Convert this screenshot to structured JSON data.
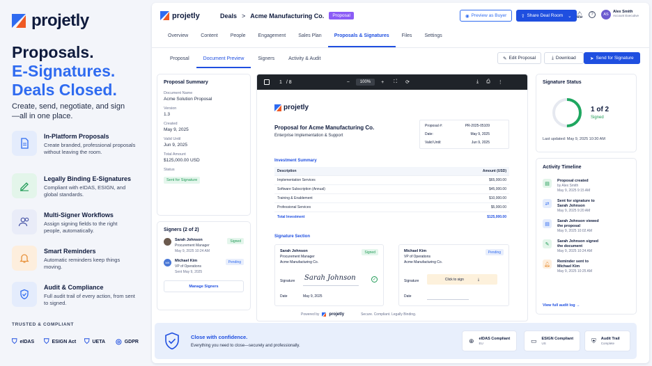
{
  "brand": {
    "name": "projetly"
  },
  "hero": {
    "line1": "Proposals.",
    "line2": "E-Signatures.",
    "line3": "Deals Closed.",
    "sub": "Create, send, negotiate, and sign—all in one place."
  },
  "features": [
    {
      "title": "In-Platform Proposals",
      "desc": "Create branded, professional proposals without leaving the room.",
      "icon": "document-icon"
    },
    {
      "title": "Legally Binding E-Signatures",
      "desc": "Compliant with eIDAS, ESIGN, and global standards.",
      "icon": "pen-signature-icon"
    },
    {
      "title": "Multi-Signer Workflows",
      "desc": "Assign signing fields to the right people, automatically.",
      "icon": "users-icon"
    },
    {
      "title": "Smart Reminders",
      "desc": "Automatic reminders keep things moving.",
      "icon": "bell-icon"
    },
    {
      "title": "Audit & Compliance",
      "desc": "Full audit trail of every action, from sent to signed.",
      "icon": "shield-check-icon"
    }
  ],
  "trusted": {
    "label": "TRUSTED & COMPLIANT",
    "items": [
      "eIDAS",
      "ESIGN Act",
      "UETA",
      "GDPR"
    ]
  },
  "topbar": {
    "crumb_root": "Deals",
    "crumb_sep": ">",
    "crumb_current": "Acme Manufacturing Co.",
    "pill": "Proposal",
    "preview_btn": "Preview as Buyer",
    "share_btn": "Share Deal Room",
    "user_initials": "AS",
    "user_name": "Alex Smith",
    "user_role": "Account Executive"
  },
  "main_tabs": [
    "Overview",
    "Content",
    "People",
    "Engagement",
    "Sales Plan",
    "Proposals & Signatures",
    "Files",
    "Settings"
  ],
  "main_tab_active": "Proposals & Signatures",
  "sub_tabs": [
    "Proposal",
    "Document Preview",
    "Signers",
    "Activity & Audit"
  ],
  "actions": {
    "edit": "Edit Proposal",
    "download": "Download",
    "send": "Send for Signature"
  },
  "summary": {
    "title": "Proposal Summary",
    "doc_name_label": "Document Name",
    "doc_name": "Acme Solution Proposal",
    "version_label": "Version",
    "version": "1.3",
    "created_label": "Created",
    "created": "May 9, 2025",
    "valid_label": "Valid Until",
    "valid": "Jun 9, 2025",
    "total_label": "Total Amount",
    "total": "$125,000.00 USD",
    "status_label": "Status",
    "status": "Sent for Signature"
  },
  "signers_card": {
    "title": "Signers (2 of 2)",
    "manage": "Manage Signers",
    "signers": [
      {
        "name": "Sarah Johnson",
        "role": "Procurement Manager",
        "date": "May 9, 2025 10:24 AM",
        "status": "Signed"
      },
      {
        "initials": "MK",
        "name": "Michael Kim",
        "role": "VP of Operations",
        "date": "Sent May 9, 2025",
        "status": "Pending"
      }
    ]
  },
  "viewer": {
    "page": "1",
    "pages": "/ 8",
    "zoom": "100%"
  },
  "doc": {
    "title": "Proposal for Acme Manufacturing Co.",
    "subtitle": "Enterprise Implementation & Support",
    "meta": [
      {
        "k": "Proposal #:",
        "v": "PR-2025-05109"
      },
      {
        "k": "Date:",
        "v": "May 9, 2025"
      },
      {
        "k": "Valid Until:",
        "v": "Jun 9, 2025"
      }
    ],
    "inv_title": "Investment Summary",
    "col_desc": "Description",
    "col_amt": "Amount (USD)",
    "rows": [
      {
        "d": "Implementation Services",
        "a": "$65,000.00"
      },
      {
        "d": "Software Subscription (Annual)",
        "a": "$45,000.00"
      },
      {
        "d": "Training & Enablement",
        "a": "$10,000.00"
      },
      {
        "d": "Professional Services",
        "a": "$5,000.00"
      }
    ],
    "total_label": "Total Investment",
    "total": "$125,000.00",
    "sig_title": "Signature Section",
    "sig1": {
      "name": "Sarah Johnson",
      "role": "Procurement Manager",
      "company": "Acme Manufacturing Co.",
      "badge": "Signed",
      "sig_label": "Signature",
      "sig": "Sarah Johnson",
      "date_label": "Date",
      "date": "May 9, 2025"
    },
    "sig2": {
      "name": "Michael Kim",
      "role": "VP of Operations",
      "company": "Acme Manufacturing Co.",
      "badge": "Pending",
      "sig_label": "Signature",
      "click": "Click to sign",
      "date_label": "Date"
    },
    "powered": "Powered by",
    "footer_note": "Secure. Compliant. Legally Binding."
  },
  "sig_status": {
    "title": "Signature Status",
    "count": "1 of 2",
    "label": "Signed",
    "signed": 1,
    "total": 2,
    "updated": "Last updated: May 9, 2025 10:30 AM"
  },
  "timeline": {
    "title": "Activity Timeline",
    "link": "View full audit log →",
    "items": [
      {
        "t": "Proposal created",
        "s1": "by Alex Smith",
        "s2": "May 9, 2025 9:15 AM",
        "icon": "document-icon",
        "color": "#1f9a55"
      },
      {
        "t": "Sent for signature to Sarah Johnson",
        "s1": "",
        "s2": "May 9, 2025 9:20 AM",
        "icon": "send-icon",
        "color": "#2f6bf0"
      },
      {
        "t": "Sarah Johnson viewed the proposal",
        "s1": "",
        "s2": "May 9, 2025 10:02 AM",
        "icon": "eye-document-icon",
        "color": "#2f6bf0"
      },
      {
        "t": "Sarah Johnson signed the document",
        "s1": "",
        "s2": "May 9, 2025 10:24 AM",
        "icon": "pen-icon",
        "color": "#1f9a55"
      },
      {
        "t": "Reminder sent to Michael Kim",
        "s1": "",
        "s2": "May 9, 2025 10:25 AM",
        "icon": "bell-icon",
        "color": "#e8913a"
      }
    ]
  },
  "banner": {
    "title": "Close with confidence.",
    "sub": "Everything you need to close—securely and professionally.",
    "badges": [
      {
        "t": "eIDAS Compliant",
        "s": "EU"
      },
      {
        "t": "ESIGN Compliant",
        "s": "US"
      },
      {
        "t": "Audit Trail",
        "s": "Complete"
      }
    ]
  }
}
